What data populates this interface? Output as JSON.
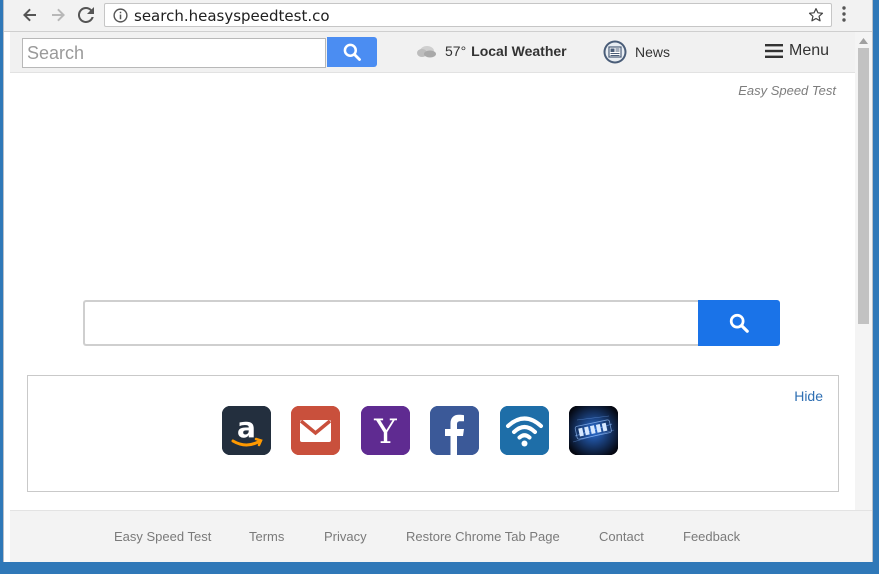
{
  "browser": {
    "url": "search.heasyspeedtest.co"
  },
  "header": {
    "search_placeholder": "Search",
    "weather_temp": "57°",
    "weather_label": "Local Weather",
    "news_label": "News",
    "menu_label": "Menu"
  },
  "brand": "Easy Speed Test",
  "quicklinks": {
    "hide_label": "Hide",
    "tiles": [
      {
        "icon": "amazon-icon",
        "color": "#232f3e"
      },
      {
        "icon": "gmail-icon",
        "color": "#c9503c"
      },
      {
        "icon": "yahoo-icon",
        "color": "#5f2b91"
      },
      {
        "icon": "facebook-icon",
        "color": "#3b5998"
      },
      {
        "icon": "wifi-icon",
        "color": "#1e6ea8"
      },
      {
        "icon": "speed-icon",
        "color": "#0a0f1c"
      }
    ]
  },
  "footer": {
    "links": [
      "Easy Speed Test",
      "Terms",
      "Privacy",
      "Restore Chrome Tab Page",
      "Contact",
      "Feedback"
    ]
  },
  "colors": {
    "accent": "#1a73e8",
    "header_search_button": "#4b8df2",
    "link": "#2f6fb3",
    "desktop": "#2f78b8"
  }
}
